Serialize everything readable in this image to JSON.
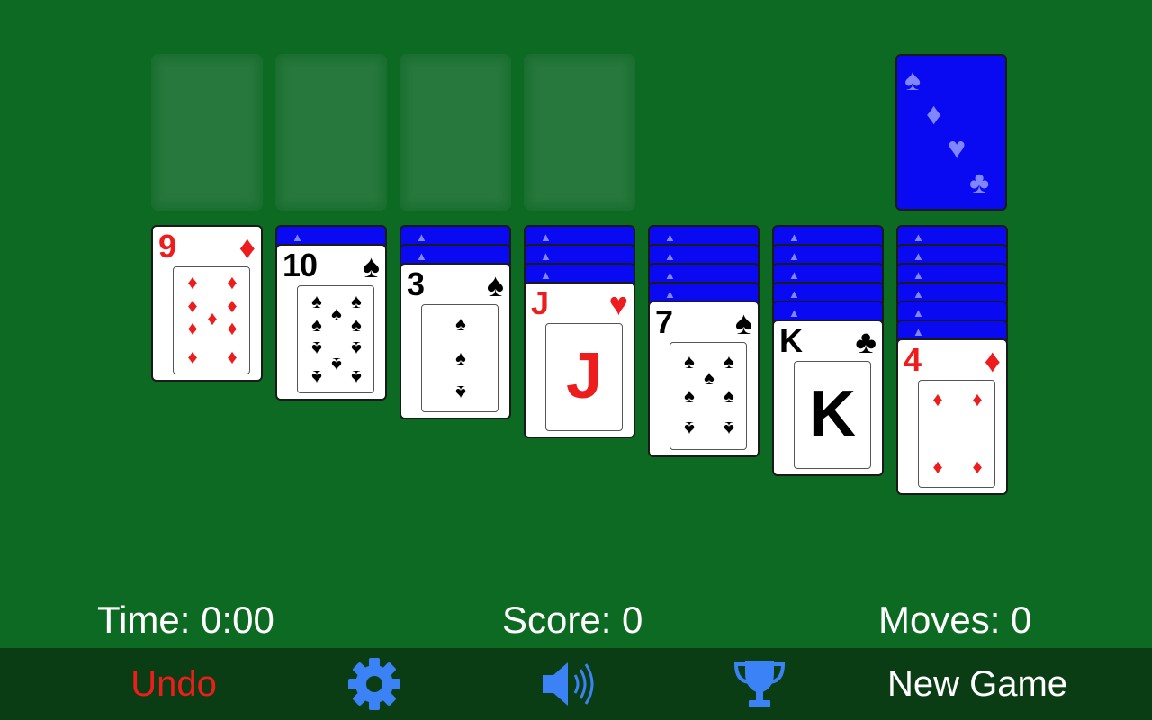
{
  "status": {
    "time": "Time: 0:00",
    "score": "Score: 0",
    "moves": "Moves: 0"
  },
  "toolbar": {
    "undo_label": "Undo",
    "new_game_label": "New Game"
  },
  "icons": {
    "settings": "gear-icon",
    "sound": "speaker-icon",
    "stats": "trophy-icon"
  },
  "colors": {
    "felt": "#0c6a22",
    "toolbar": "#0a3d14",
    "card_back": "#0a0af2",
    "red_suit": "#ee1d1d",
    "icon_blue": "#3b82f6"
  },
  "foundations": [
    {
      "empty": true
    },
    {
      "empty": true
    },
    {
      "empty": true
    },
    {
      "empty": true
    }
  ],
  "stock": {
    "face_down": true
  },
  "tableau": [
    {
      "hidden": 0,
      "rank": "9",
      "suit": "♦",
      "color": "red"
    },
    {
      "hidden": 1,
      "rank": "10",
      "suit": "♠",
      "color": "black"
    },
    {
      "hidden": 2,
      "rank": "3",
      "suit": "♠",
      "color": "black"
    },
    {
      "hidden": 3,
      "rank": "J",
      "suit": "♥",
      "color": "red"
    },
    {
      "hidden": 4,
      "rank": "7",
      "suit": "♠",
      "color": "black"
    },
    {
      "hidden": 5,
      "rank": "K",
      "suit": "♣",
      "color": "black"
    },
    {
      "hidden": 6,
      "rank": "4",
      "suit": "♦",
      "color": "red"
    }
  ]
}
